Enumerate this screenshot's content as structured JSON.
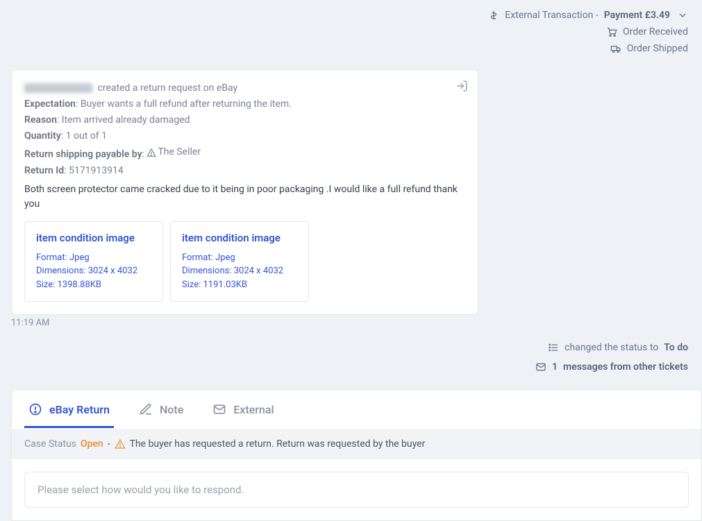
{
  "topEvents": {
    "transaction": {
      "prefix": "External Transaction -",
      "label": "Payment £3.49"
    },
    "received": "Order Received",
    "shipped": "Order Shipped"
  },
  "card": {
    "createdSuffix": "created a return request on eBay",
    "expectationLabel": "Expectation",
    "expectationValue": "Buyer wants a full refund after returning the item.",
    "reasonLabel": "Reason",
    "reasonValue": "Item arrived already damaged",
    "quantityLabel": "Quantity",
    "quantityValue": "1 out of 1",
    "payableLabel": "Return shipping payable by",
    "payableValue": "The Seller",
    "returnIdLabel": "Return Id",
    "returnIdValue": "5171913914",
    "buyerMessage": "Both screen protector came cracked due to it being in poor packaging .I would like a full refund thank you"
  },
  "attachments": [
    {
      "title": "item condition image",
      "format": "Format: Jpeg",
      "dimensions": "Dimensions: 3024 x 4032",
      "size": "Size: 1398.88KB"
    },
    {
      "title": "item condition image",
      "format": "Format: Jpeg",
      "dimensions": "Dimensions: 3024 x 4032",
      "size": "Size: 1191.03KB"
    }
  ],
  "timestamp": "11:19 AM",
  "midEvents": {
    "statusPrefix": "changed the status to",
    "statusValue": "To do",
    "messagesCount": "1",
    "messagesSuffix": "messages from other tickets"
  },
  "tabs": {
    "ebay": "eBay Return",
    "note": "Note",
    "external": "External"
  },
  "statusBar": {
    "label": "Case Status",
    "open": "Open",
    "dash": "-",
    "text": "The buyer has requested a return. Return was requested by the buyer"
  },
  "respondPlaceholder": "Please select how would you like to respond."
}
